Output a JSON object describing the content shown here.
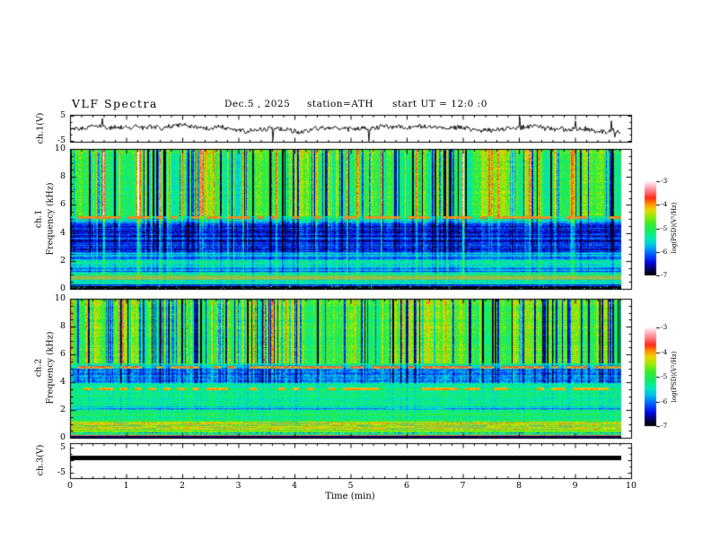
{
  "title": {
    "text": "VLF Spectra",
    "date": "Dec.5 , 2025",
    "station": "station=ATH",
    "start_ut": "start UT =  12:0 :0"
  },
  "xaxis": {
    "label": "Time  (min)",
    "ticks": [
      "0",
      "1",
      "2",
      "3",
      "4",
      "5",
      "6",
      "7",
      "8",
      "9",
      "10"
    ],
    "range_min": [
      0,
      10
    ]
  },
  "panels": {
    "ch1_wave": {
      "ylabel": "ch.1(V)",
      "yticks": [
        "5",
        "-5"
      ],
      "yrange": [
        -5,
        5
      ]
    },
    "ch1_spec": {
      "name": "ch.1",
      "ylabel": "Frequency  (kHz)",
      "yticks": [
        "10",
        "8",
        "6",
        "4",
        "2",
        "0"
      ],
      "yrange": [
        0,
        10
      ]
    },
    "ch2_spec": {
      "name": "ch.2",
      "ylabel": "Frequency  (kHz)",
      "yticks": [
        "10",
        "8",
        "6",
        "4",
        "2",
        "0"
      ],
      "yrange": [
        0,
        10
      ]
    },
    "ch3_wave": {
      "ylabel": "ch.3(V)",
      "yticks": [
        "5",
        "-5"
      ],
      "yrange": [
        -5,
        5
      ]
    }
  },
  "colorbars": [
    {
      "label": "log(PSD)(V²/Hz)",
      "ticks": [
        "-3",
        "-4",
        "-5",
        "-6",
        "-7"
      ],
      "range": [
        -7,
        -3
      ]
    },
    {
      "label": "log(PSD)(V²/Hz)",
      "ticks": [
        "-3",
        "-4",
        "-5",
        "-6",
        "-7"
      ],
      "range": [
        -7,
        -3
      ]
    }
  ],
  "chart_data": [
    {
      "type": "line",
      "panel": "ch.1 time series",
      "ylabel": "ch.1(V)",
      "ylim": [
        -5,
        5
      ],
      "xlabel": "Time (min)",
      "xlim": [
        0,
        10
      ],
      "summary": "Dense noisy black waveform centered near 0 V, fluctuations about ±1.5 V, frequent impulsive spikes reaching -5 and +5 V; data extend from 0 to about 9.8 min."
    },
    {
      "type": "heatmap",
      "panel": "ch.1 spectrogram",
      "ylabel": "Frequency (kHz)",
      "ylim": [
        0,
        10
      ],
      "xlabel": "Time (min)",
      "xlim": [
        0,
        10
      ],
      "colorbar": {
        "label": "log(PSD)(V²/Hz)",
        "min": -7,
        "max": -3
      },
      "bands": [
        {
          "freq_khz": [
            5.2,
            10
          ],
          "level": "green ~ -5 with many vertical sferic streaks: yellow bursts and narrow dark/black dropout lines; red speckle near 10 kHz"
        },
        {
          "freq_khz": [
            5.0,
            5.2
          ],
          "level": "intermittent brown/red horizontal line ~ -4"
        },
        {
          "freq_khz": [
            2.6,
            4.4
          ],
          "level": "dark blue ~ -6.4 with cyan speckle, horizontal striping and cyan vertical streaks"
        },
        {
          "freq_khz": [
            1.0,
            2.6
          ],
          "level": "blue-cyan horizontal bands ~ -5.5 to -6"
        },
        {
          "freq_khz": [
            0.6,
            1.0
          ],
          "level": "muted olive/tan horizontal band ~ -4.6"
        },
        {
          "freq_khz": [
            0.2,
            0.6
          ],
          "level": "cyan/blue speckle"
        },
        {
          "freq_khz": [
            0,
            0.2
          ],
          "level": "black baseline row ~ -7"
        }
      ]
    },
    {
      "type": "heatmap",
      "panel": "ch.2 spectrogram",
      "ylabel": "Frequency (kHz)",
      "ylim": [
        0,
        10
      ],
      "xlabel": "Time (min)",
      "xlim": [
        0,
        10
      ],
      "colorbar": {
        "label": "log(PSD)(V²/Hz)",
        "min": -7,
        "max": -3
      },
      "bands": [
        {
          "freq_khz": [
            5.35,
            10
          ],
          "level": "green ~ -4.9 with dense narrow dark/blue vertical streaks"
        },
        {
          "freq_khz": [
            5.0,
            5.15
          ],
          "level": "intermittent brown horizontal line ~ -4"
        },
        {
          "freq_khz": [
            3.95,
            5.0
          ],
          "level": "blue speckled band ~ -6"
        },
        {
          "freq_khz": [
            3.4,
            3.6
          ],
          "level": "dashed red/orange horizontal line ~ -4"
        },
        {
          "freq_khz": [
            2.3,
            3.4
          ],
          "level": "green-cyan ~ -5.25"
        },
        {
          "freq_khz": [
            1.95,
            2.3
          ],
          "level": "dark olive horizontal striping"
        },
        {
          "freq_khz": [
            0.6,
            1.1
          ],
          "level": "orange/red band ~ -4.3 with gray patches"
        },
        {
          "freq_khz": [
            0.3,
            0.6
          ],
          "level": "yellow-green rows"
        },
        {
          "freq_khz": [
            0,
            0.18
          ],
          "level": "black bottom row with thin dark-red line just above"
        }
      ]
    },
    {
      "type": "line",
      "panel": "ch.3 time series",
      "ylabel": "ch.3(V)",
      "ylim": [
        -5,
        5
      ],
      "xlabel": "Time (min)",
      "xlim": [
        0,
        10
      ],
      "summary": "Flat constant signal ~ 0 V drawn as a thick solid black bar from 0 to about 9.8 min."
    }
  ]
}
